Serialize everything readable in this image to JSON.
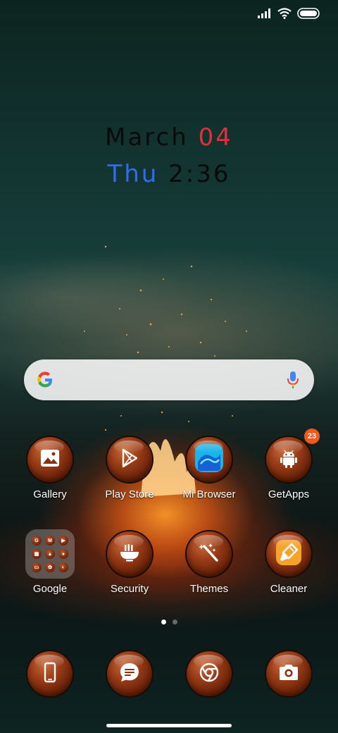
{
  "clock": {
    "month": "March",
    "day": "04",
    "weekday": "Thu",
    "time": "2:36"
  },
  "status_bar": {
    "icons": [
      "signal-icon",
      "wifi-icon",
      "battery-icon"
    ]
  },
  "search": {
    "left_icon": "google-g-icon",
    "right_icon": "microphone-icon"
  },
  "row1": [
    {
      "label": "Gallery",
      "icon": "image-icon"
    },
    {
      "label": "Play Store",
      "icon": "play-store-icon"
    },
    {
      "label": "Mi Browser",
      "icon": "mi-browser-icon"
    },
    {
      "label": "GetApps",
      "icon": "android-icon",
      "badge": "23"
    }
  ],
  "row2": [
    {
      "label": "Google",
      "icon": "folder-icon",
      "folder_items": [
        "G",
        "M",
        "▶",
        "▦",
        "▲",
        "●",
        "▭",
        "✿",
        "◐"
      ]
    },
    {
      "label": "Security",
      "icon": "security-icon"
    },
    {
      "label": "Themes",
      "icon": "magic-wand-icon"
    },
    {
      "label": "Cleaner",
      "icon": "broom-icon"
    }
  ],
  "dock": [
    {
      "icon": "phone-icon"
    },
    {
      "icon": "messages-icon"
    },
    {
      "icon": "chrome-icon"
    },
    {
      "icon": "camera-icon"
    }
  ],
  "pages": {
    "count": 2,
    "active": 1
  },
  "colors": {
    "day_red": "#e0303c",
    "weekday_blue": "#2f6cf0",
    "badge_orange": "#f05a1e"
  }
}
